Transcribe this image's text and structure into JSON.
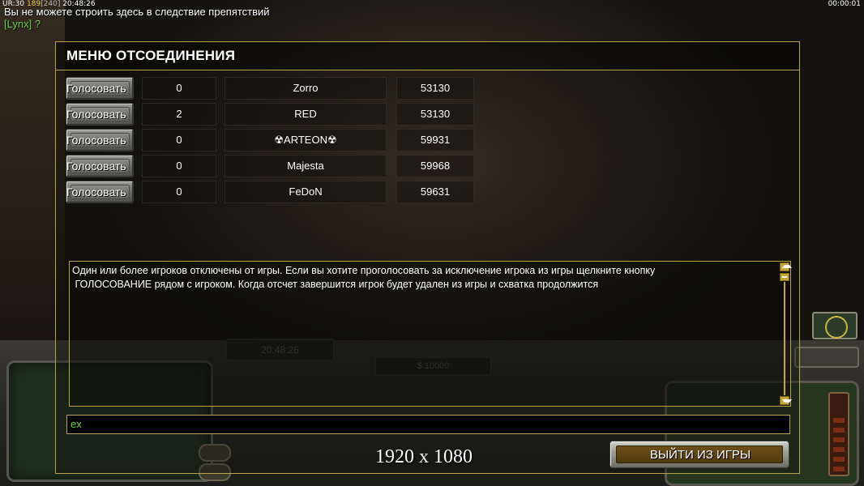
{
  "hud": {
    "stats_prefix": "UR:30",
    "stats_a": "189",
    "stats_b": "[240]",
    "stats_time": "20:48:26",
    "clock": "00:00:01",
    "message": "Вы не можете строить здесь в следствие препятствий",
    "chat_line": "[Lynx] ?"
  },
  "background": {
    "clock_hint": "20:48:26",
    "money_hint": "$ 10000"
  },
  "dialog": {
    "title": "МЕНЮ ОТСОЕДИНЕНИЯ",
    "vote_label": "Голосовать",
    "players": [
      {
        "votes": "0",
        "name": "Zorro",
        "ping": "53130"
      },
      {
        "votes": "2",
        "name": "RED",
        "ping": "53130"
      },
      {
        "votes": "0",
        "name": "☢ARTEON☢",
        "ping": "59931"
      },
      {
        "votes": "0",
        "name": "Majesta",
        "ping": "59968"
      },
      {
        "votes": "0",
        "name": "FeDoN",
        "ping": "59631"
      }
    ],
    "info_text": "Один или более игроков отключены от игры. Если вы хотите проголосовать за исключение игрока из игры щелкните кнопку\n ГОЛОСОВАНИЕ рядом с игроком. Когда отсчет завершится игрок будет удален из игры и схватка продолжится",
    "chat_value": "ex",
    "exit_label": "ВЫЙТИ ИЗ ИГРЫ"
  },
  "overlay": {
    "resolution": "1920 x 1080"
  },
  "colors": {
    "accent_gold": "#b8a24a",
    "chat_green": "#6ad33a"
  }
}
